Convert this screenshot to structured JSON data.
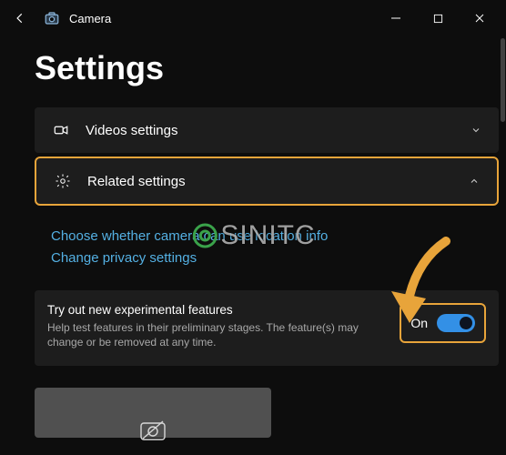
{
  "titlebar": {
    "app": "Camera"
  },
  "page": {
    "title": "Settings"
  },
  "panels": {
    "videos": {
      "label": "Videos settings"
    },
    "related": {
      "label": "Related settings"
    }
  },
  "links": {
    "location": "Choose whether camera can use location info",
    "privacy": "Change privacy settings"
  },
  "features": {
    "title": "Try out new experimental features",
    "desc": "Help test features in their preliminary stages. The feature(s) may change or be removed at any time.",
    "toggle_label": "On"
  },
  "watermark": {
    "text_a": "SINITC"
  }
}
